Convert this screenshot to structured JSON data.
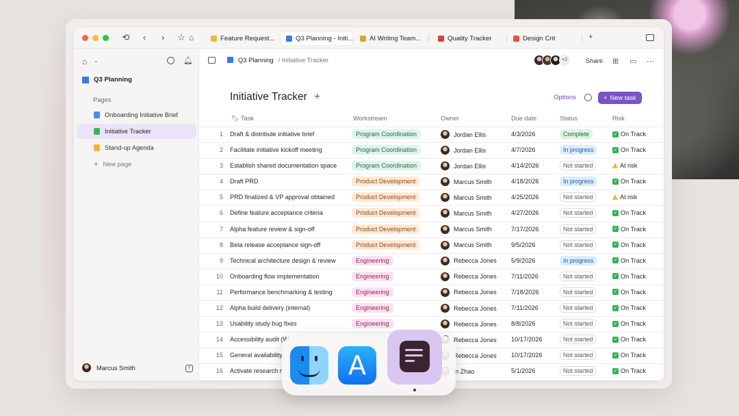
{
  "browser": {
    "tabs": [
      {
        "label": "Feature Request...",
        "color": "#f2b53a"
      },
      {
        "label": "Q3 Planning - Initi...",
        "color": "#3b7be0"
      },
      {
        "label": "AI Writing Team...",
        "color": "#e0a13b"
      },
      {
        "label": "Quality Tracker",
        "color": "#d94040"
      },
      {
        "label": "Design Crit",
        "color": "#e0553b"
      }
    ],
    "new_tab": "+"
  },
  "sidebar": {
    "workspace": "Q3 Planning",
    "pages_label": "Pages",
    "items": [
      {
        "label": "Onboarding Initiative Brief",
        "color": "#4a8ae8"
      },
      {
        "label": "Initiative Tracker",
        "color": "#3bb45f"
      },
      {
        "label": "Stand-up Agenda",
        "color": "#f2b53a"
      }
    ],
    "new_page": "New page",
    "user": "Marcus Smith",
    "help": "?"
  },
  "header": {
    "breadcrumb_root": "Q3 Planning",
    "breadcrumb_sub": "/ Initiative Tracker",
    "more_avatars": "+2",
    "share": "Share"
  },
  "page": {
    "title": "Initiative Tracker",
    "options": "Options",
    "new_task": "New task"
  },
  "table": {
    "columns": {
      "task": "Task",
      "workstream": "Workstream",
      "owner": "Owner",
      "due": "Due date",
      "status": "Status",
      "risk": "Risk"
    },
    "rows": [
      {
        "n": "1",
        "task": "Draft & distribute initiative brief",
        "ws": "Program Coordination",
        "owner": "Jordan Ellis",
        "due": "4/3/2026",
        "status": "Complete",
        "risk": "On Track"
      },
      {
        "n": "2",
        "task": "Facilitate initiative kickoff meeting",
        "ws": "Program Coordination",
        "owner": "Jordan Ellis",
        "due": "4/7/2026",
        "status": "In progress",
        "risk": "On Track"
      },
      {
        "n": "3",
        "task": "Establish shared documentation space",
        "ws": "Program Coordination",
        "owner": "Jordan Ellis",
        "due": "4/14/2026",
        "status": "Not started",
        "risk": "At risk"
      },
      {
        "n": "4",
        "task": "Draft PRD",
        "ws": "Product Development",
        "owner": "Marcus Smith",
        "due": "4/18/2026",
        "status": "In progress",
        "risk": "On Track"
      },
      {
        "n": "5",
        "task": "PRD finalized & VP approval obtained",
        "ws": "Product Development",
        "owner": "Marcus Smith",
        "due": "4/25/2026",
        "status": "Not started",
        "risk": "At risk"
      },
      {
        "n": "6",
        "task": "Define feature acceptance criteria",
        "ws": "Product Development",
        "owner": "Marcus Smith",
        "due": "4/27/2026",
        "status": "Not started",
        "risk": "On Track"
      },
      {
        "n": "7",
        "task": "Alpha feature review & sign-off",
        "ws": "Product Development",
        "owner": "Marcus Smith",
        "due": "7/17/2026",
        "status": "Not started",
        "risk": "On Track"
      },
      {
        "n": "8",
        "task": "Beta release acceptance sign-off",
        "ws": "Product Development",
        "owner": "Marcus Smith",
        "due": "9/5/2026",
        "status": "Not started",
        "risk": "On Track"
      },
      {
        "n": "9",
        "task": "Technical architecture design & review",
        "ws": "Engineering",
        "owner": "Rebecca Jones",
        "due": "5/9/2026",
        "status": "In progress",
        "risk": "On Track"
      },
      {
        "n": "10",
        "task": "Onboarding flow implementation",
        "ws": "Engineering",
        "owner": "Rebecca Jones",
        "due": "7/11/2026",
        "status": "Not started",
        "risk": "On Track"
      },
      {
        "n": "11",
        "task": "Performance benchmarking & testing",
        "ws": "Engineering",
        "owner": "Rebecca Jones",
        "due": "7/18/2026",
        "status": "Not started",
        "risk": "On Track"
      },
      {
        "n": "12",
        "task": "Alpha build delivery (internal)",
        "ws": "Engineering",
        "owner": "Rebecca Jones",
        "due": "7/11/2026",
        "status": "Not started",
        "risk": "On Track"
      },
      {
        "n": "13",
        "task": "Usability study bug fixes",
        "ws": "Engineering",
        "owner": "Rebecca Jones",
        "due": "8/8/2026",
        "status": "Not started",
        "risk": "On Track"
      },
      {
        "n": "14",
        "task": "Accessibility audit (W",
        "ws": "",
        "owner": "Rebecca Jones",
        "due": "10/17/2026",
        "status": "Not started",
        "risk": "On Track"
      },
      {
        "n": "15",
        "task": "General availability",
        "ws": "",
        "owner": "Rebecca Jones",
        "due": "10/17/2026",
        "status": "Not started",
        "risk": "On Track"
      },
      {
        "n": "16",
        "task": "Activate research r",
        "ws": "",
        "owner": "in Zhao",
        "due": "5/1/2026",
        "status": "Not started",
        "risk": "On Track"
      }
    ]
  },
  "dock": {
    "apps": [
      "finder-icon",
      "app-store-icon",
      "craft-icon"
    ]
  }
}
